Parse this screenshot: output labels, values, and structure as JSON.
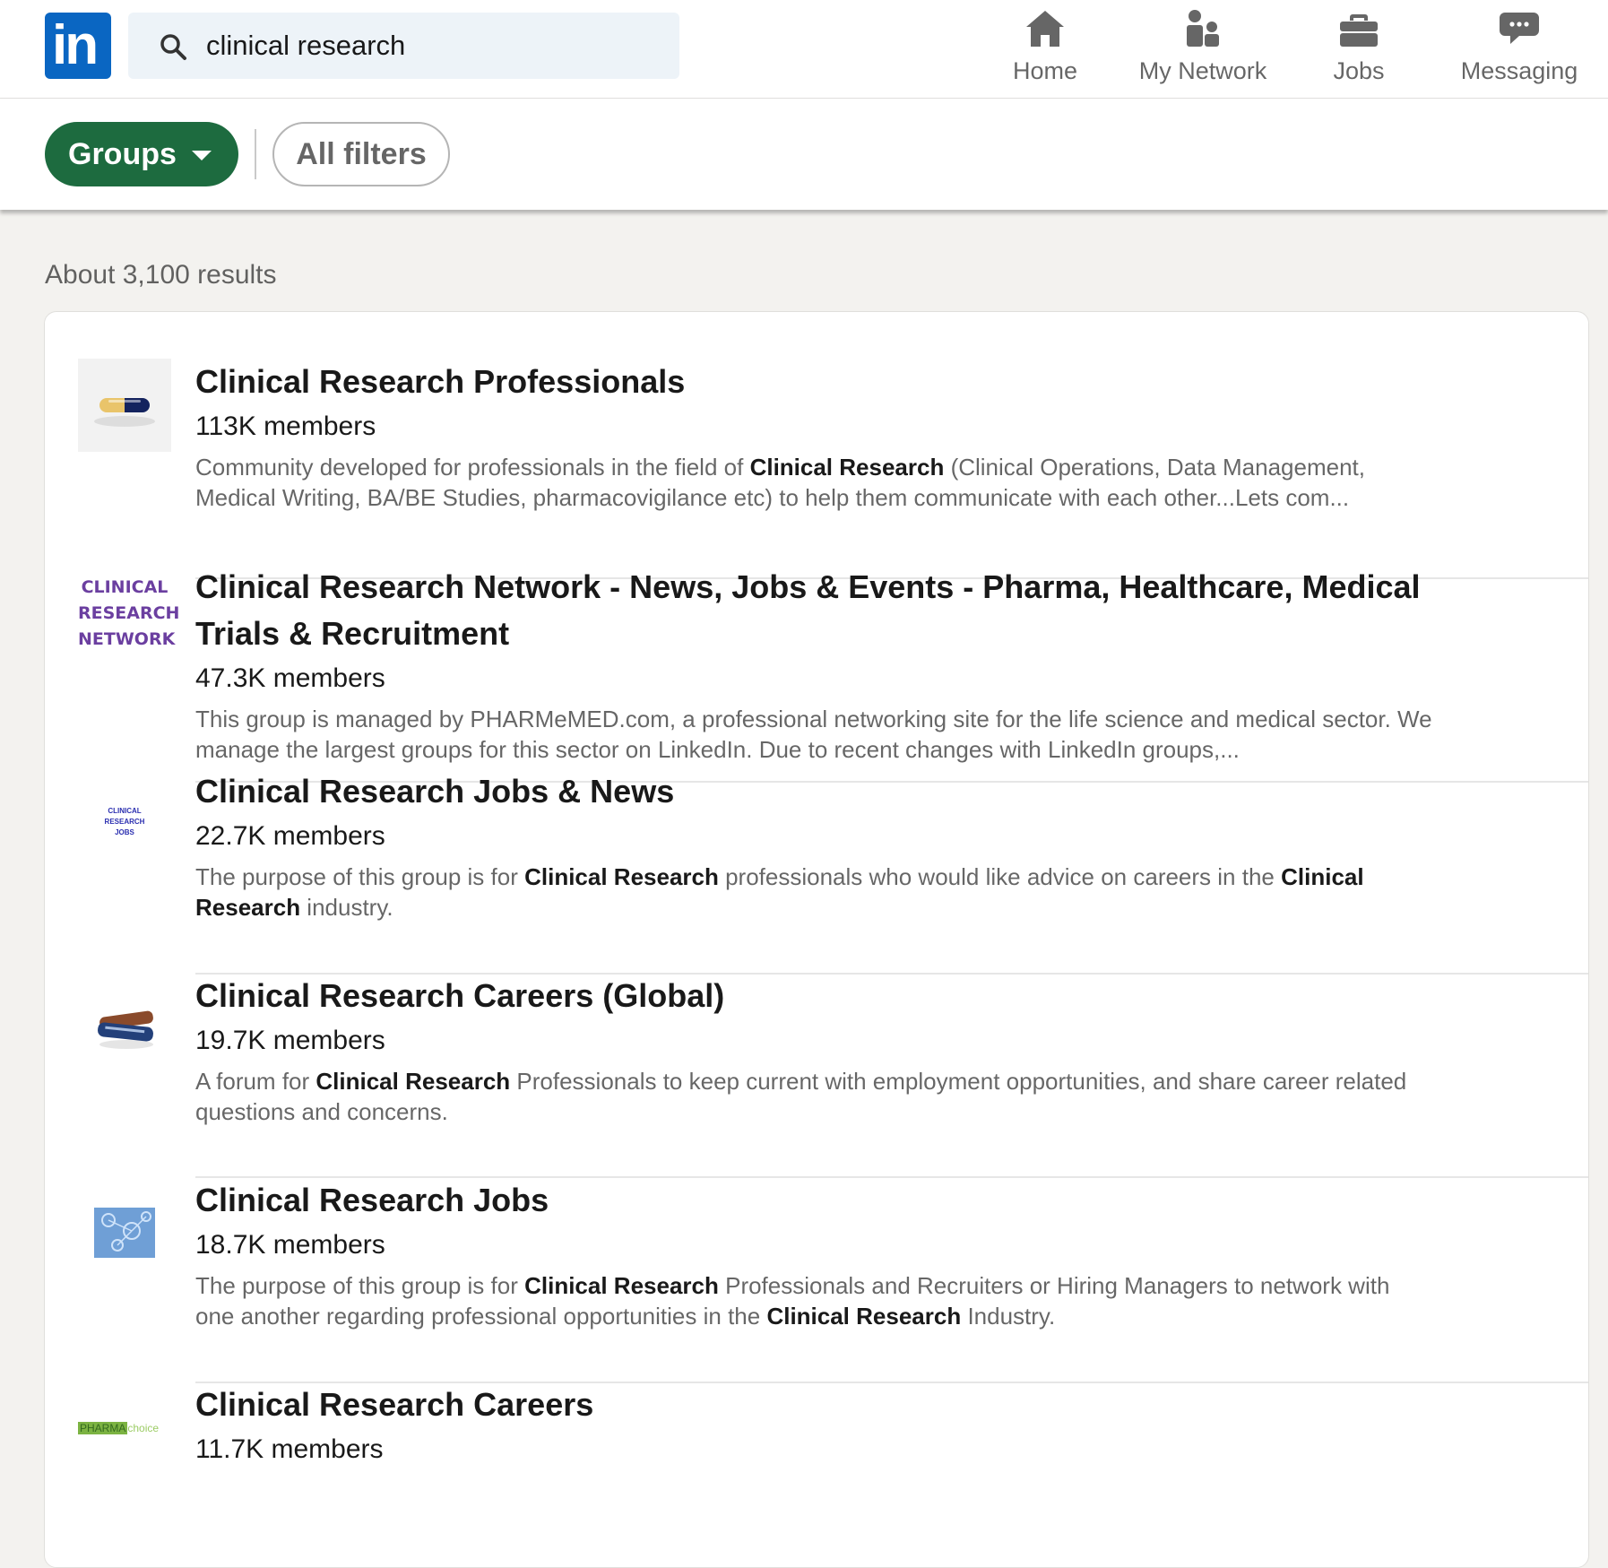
{
  "search": {
    "query": "clinical research"
  },
  "nav": [
    {
      "label": "Home",
      "icon": "home-icon"
    },
    {
      "label": "My Network",
      "icon": "network-icon"
    },
    {
      "label": "Jobs",
      "icon": "briefcase-icon"
    },
    {
      "label": "Messaging",
      "icon": "messaging-icon"
    }
  ],
  "filters": {
    "groups_label": "Groups",
    "all_filters_label": "All filters"
  },
  "results": {
    "count_text": "About 3,100 results",
    "items": [
      {
        "title": "Clinical Research Professionals",
        "members": "113K members",
        "desc_parts": [
          {
            "t": "Community developed for professionals in the field of ",
            "b": false
          },
          {
            "t": "Clinical Research",
            "b": true
          },
          {
            "t": " (Clinical Operations, Data Management, Medical Writing, BA/BE Studies, pharmacovigilance etc) to help them communicate with each other...Lets com...",
            "b": false
          }
        ]
      },
      {
        "title": "Clinical Research Network - News, Jobs & Events - Pharma, Healthcare, Medical Trials & Recruitment",
        "members": "47.3K members",
        "desc_parts": [
          {
            "t": "This group is managed by PHARMeMED.com, a professional networking site for the life science and medical sector. We manage the largest groups for this sector on LinkedIn. Due to recent changes with LinkedIn groups,...",
            "b": false
          }
        ]
      },
      {
        "title": "Clinical Research Jobs & News",
        "members": "22.7K members",
        "desc_parts": [
          {
            "t": "The purpose of this group is for ",
            "b": false
          },
          {
            "t": "Clinical Research",
            "b": true
          },
          {
            "t": " professionals who would like advice on careers in the ",
            "b": false
          },
          {
            "t": "Clinical Research",
            "b": true
          },
          {
            "t": " industry.",
            "b": false
          }
        ]
      },
      {
        "title": "Clinical Research Careers (Global)",
        "members": "19.7K members",
        "desc_parts": [
          {
            "t": "A forum for ",
            "b": false
          },
          {
            "t": "Clinical Research",
            "b": true
          },
          {
            "t": " Professionals to keep current with employment opportunities, and share career related questions and concerns.",
            "b": false
          }
        ]
      },
      {
        "title": "Clinical Research Jobs",
        "members": "18.7K members",
        "desc_parts": [
          {
            "t": "The purpose of this group is for ",
            "b": false
          },
          {
            "t": "Clinical Research",
            "b": true
          },
          {
            "t": " Professionals and Recruiters or Hiring Managers to network with one another regarding professional opportunities in the ",
            "b": false
          },
          {
            "t": "Clinical Research",
            "b": true
          },
          {
            "t": " Industry.",
            "b": false
          }
        ]
      },
      {
        "title": "Clinical Research Careers",
        "members": "11.7K members",
        "desc_parts": []
      }
    ]
  },
  "logos": {
    "crn_lines": [
      "CLINICAL",
      "RESEARCH",
      "NETWORK"
    ],
    "crjn_lines": [
      "CLINICAL",
      "RESEARCH",
      "JOBS"
    ],
    "pharma_choice": [
      "PHARMA",
      "choice"
    ]
  },
  "colors": {
    "brand": "#0a66c2",
    "groups_pill": "#1d6b3f",
    "background": "#f3f2ef"
  }
}
